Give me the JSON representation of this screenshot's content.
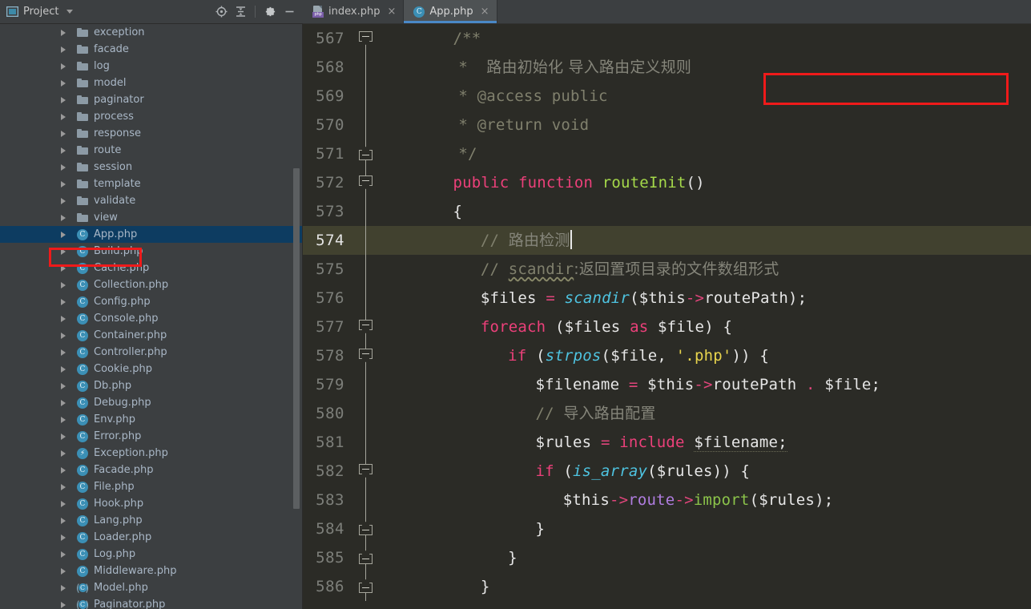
{
  "project_panel": {
    "title": "Project",
    "dropdown_icon": "chevron-down-icon",
    "tools": [
      {
        "name": "locate-target-icon",
        "label": "⊕"
      },
      {
        "name": "collapse-all-icon",
        "label": "≑"
      },
      {
        "name": "settings-gear-icon",
        "label": "⚙"
      },
      {
        "name": "minimize-icon",
        "label": "—"
      }
    ],
    "tree": [
      {
        "label": "exception",
        "type": "folder"
      },
      {
        "label": "facade",
        "type": "folder"
      },
      {
        "label": "log",
        "type": "folder"
      },
      {
        "label": "model",
        "type": "folder"
      },
      {
        "label": "paginator",
        "type": "folder"
      },
      {
        "label": "process",
        "type": "folder"
      },
      {
        "label": "response",
        "type": "folder"
      },
      {
        "label": "route",
        "type": "folder"
      },
      {
        "label": "session",
        "type": "folder"
      },
      {
        "label": "template",
        "type": "folder"
      },
      {
        "label": "validate",
        "type": "folder"
      },
      {
        "label": "view",
        "type": "folder"
      },
      {
        "label": "App.php",
        "type": "class",
        "selected": true
      },
      {
        "label": "Build.php",
        "type": "class"
      },
      {
        "label": "Cache.php",
        "type": "class"
      },
      {
        "label": "Collection.php",
        "type": "class"
      },
      {
        "label": "Config.php",
        "type": "class"
      },
      {
        "label": "Console.php",
        "type": "class"
      },
      {
        "label": "Container.php",
        "type": "class"
      },
      {
        "label": "Controller.php",
        "type": "class"
      },
      {
        "label": "Cookie.php",
        "type": "class"
      },
      {
        "label": "Db.php",
        "type": "class"
      },
      {
        "label": "Debug.php",
        "type": "class"
      },
      {
        "label": "Env.php",
        "type": "class"
      },
      {
        "label": "Error.php",
        "type": "class"
      },
      {
        "label": "Exception.php",
        "type": "exception"
      },
      {
        "label": "Facade.php",
        "type": "class"
      },
      {
        "label": "File.php",
        "type": "class"
      },
      {
        "label": "Hook.php",
        "type": "class"
      },
      {
        "label": "Lang.php",
        "type": "class"
      },
      {
        "label": "Loader.php",
        "type": "class"
      },
      {
        "label": "Log.php",
        "type": "class"
      },
      {
        "label": "Middleware.php",
        "type": "class"
      },
      {
        "label": "Model.php",
        "type": "abstract-class"
      },
      {
        "label": "Paginator.php",
        "type": "abstract-class"
      }
    ]
  },
  "tabs": [
    {
      "label": "index.php",
      "icon": "php-file-icon",
      "active": false,
      "close": "×"
    },
    {
      "label": "App.php",
      "icon": "php-class-icon",
      "active": true,
      "close": "×"
    }
  ],
  "editor": {
    "current_line": 574,
    "lines": [
      {
        "num": "567",
        "fold": "down"
      },
      {
        "num": "568",
        "fold": "none"
      },
      {
        "num": "569",
        "fold": "none"
      },
      {
        "num": "570",
        "fold": "none"
      },
      {
        "num": "571",
        "fold": "up"
      },
      {
        "num": "572",
        "fold": "down"
      },
      {
        "num": "573",
        "fold": "none"
      },
      {
        "num": "574",
        "fold": "none"
      },
      {
        "num": "575",
        "fold": "none"
      },
      {
        "num": "576",
        "fold": "none"
      },
      {
        "num": "577",
        "fold": "down"
      },
      {
        "num": "578",
        "fold": "down"
      },
      {
        "num": "579",
        "fold": "none"
      },
      {
        "num": "580",
        "fold": "none"
      },
      {
        "num": "581",
        "fold": "none"
      },
      {
        "num": "582",
        "fold": "down"
      },
      {
        "num": "583",
        "fold": "none"
      },
      {
        "num": "584",
        "fold": "up"
      },
      {
        "num": "585",
        "fold": "up"
      },
      {
        "num": "586",
        "fold": "up"
      }
    ],
    "code": {
      "l567": "/**",
      "l568_star": "*",
      "l568_comment": "路由初始化 导入路由定义规则",
      "l569_star": "*",
      "l569_text": "@access public",
      "l570_star": "*",
      "l570_text": "@return void",
      "l571": "*/",
      "l572_kw1": "public",
      "l572_kw2": "function",
      "l572_name": "routeInit",
      "l572_parens": "()",
      "l573": "{",
      "l574_slashes": "//",
      "l574_text": "路由检测",
      "l575_slashes": "//",
      "l575_fn": "scandir",
      "l575_text": ":返回置项目录的文件数组形式",
      "l576_var": "$files",
      "l576_eq": "=",
      "l576_fn": "scandir",
      "l576_open": "(",
      "l576_this": "$this",
      "l576_arrow": "->",
      "l576_prop": "routePath",
      "l576_close": ");",
      "l577_kw": "foreach",
      "l577_open": "(",
      "l577_var1": "$files",
      "l577_as": "as",
      "l577_var2": "$file",
      "l577_close": ") {",
      "l578_kw": "if",
      "l578_open": "(",
      "l578_fn": "strpos",
      "l578_p1": "(",
      "l578_var": "$file",
      "l578_comma": ", ",
      "l578_str": "'.php'",
      "l578_close": ")) {",
      "l579_var": "$filename",
      "l579_eq": "=",
      "l579_this": "$this",
      "l579_arrow": "->",
      "l579_prop": "routePath",
      "l579_dot": ".",
      "l579_var2": "$file;",
      "l580_slashes": "//",
      "l580_text": "导入路由配置",
      "l581_var": "$rules",
      "l581_eq": "=",
      "l581_kw": "include",
      "l581_var2": "$filename;",
      "l582_kw": "if",
      "l582_open": "(",
      "l582_fn": "is_array",
      "l582_p1": "(",
      "l582_var": "$rules",
      "l582_close": ")) {",
      "l583_this": "$this",
      "l583_arrow1": "->",
      "l583_prop": "route",
      "l583_arrow2": "->",
      "l583_method": "import",
      "l583_open": "(",
      "l583_var": "$rules",
      "l583_close": ");",
      "l584": "}",
      "l585": "}",
      "l586": "}"
    }
  },
  "annotations": [
    {
      "name": "annotation-box-tree-app-php",
      "color": "#ef1a1a"
    },
    {
      "name": "annotation-box-code-comment",
      "color": "#ef1a1a"
    }
  ]
}
